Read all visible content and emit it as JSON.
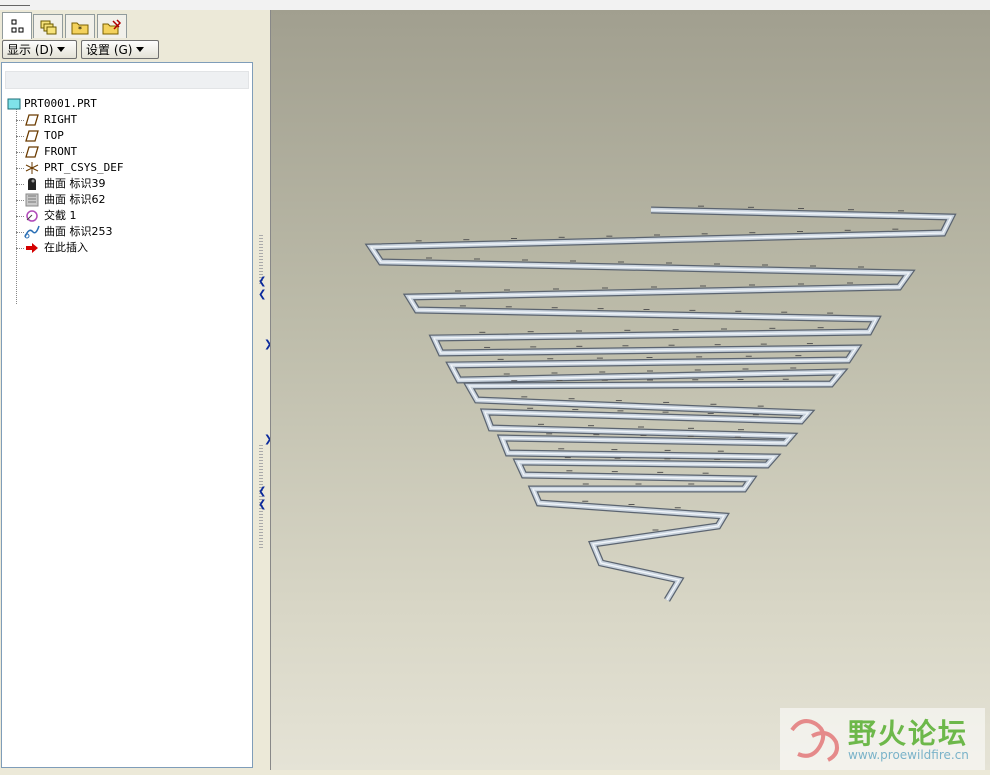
{
  "toolbar": {
    "show_label": "显示 (D)",
    "settings_label": "设置 (G)"
  },
  "tabs": [
    {
      "icon": "model-tree-icon",
      "active": true
    },
    {
      "icon": "layers-icon",
      "active": false
    },
    {
      "icon": "folder-browser-icon",
      "active": false
    },
    {
      "icon": "favorites-tools-icon",
      "active": false
    }
  ],
  "tree": {
    "root": "PRT0001.PRT",
    "items": [
      {
        "label": "RIGHT",
        "icon": "datum-plane-icon"
      },
      {
        "label": "TOP",
        "icon": "datum-plane-icon"
      },
      {
        "label": "FRONT",
        "icon": "datum-plane-icon"
      },
      {
        "label": "PRT_CSYS_DEF",
        "icon": "coordinate-system-icon"
      },
      {
        "label": "曲面 标识39",
        "icon": "surface-icon"
      },
      {
        "label": "曲面 标识62",
        "icon": "surface-copy-icon"
      },
      {
        "label": "交截 1",
        "icon": "intersect-icon"
      },
      {
        "label": "曲面 标识253",
        "icon": "sweep-surface-icon"
      },
      {
        "label": "在此插入",
        "icon": "insert-here-arrow-icon"
      }
    ]
  },
  "watermark": {
    "brand": "野火论坛",
    "url": "www.proewildfire.cn"
  },
  "colors": {
    "pipe": "#c9d3de",
    "pipe_edge": "#5b6470",
    "insert_arrow": "#d40000"
  }
}
